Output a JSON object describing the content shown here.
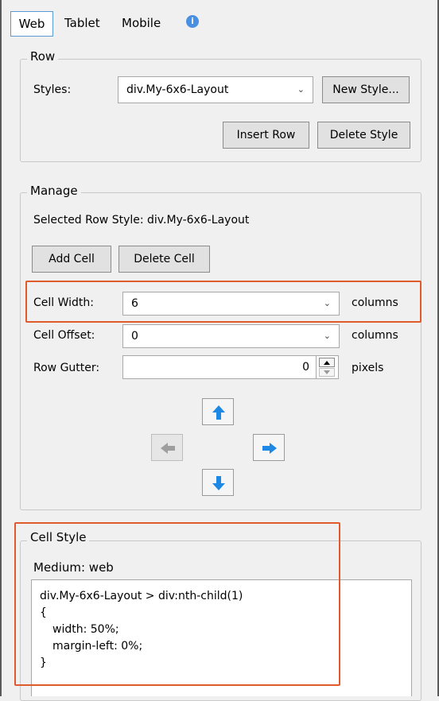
{
  "tabs": [
    "Web",
    "Tablet",
    "Mobile"
  ],
  "info_icon": "info-icon",
  "row": {
    "title": "Row",
    "styles_label": "Styles:",
    "styles_value": "div.My-6x6-Layout",
    "new_style": "New Style...",
    "insert_row": "Insert Row",
    "delete_style": "Delete Style"
  },
  "manage": {
    "title": "Manage",
    "selected_row_style": "Selected Row Style: div.My-6x6-Layout",
    "add_cell": "Add Cell",
    "delete_cell": "Delete Cell",
    "cell_width_label": "Cell Width:",
    "cell_width_value": "6",
    "cell_width_unit": "columns",
    "cell_offset_label": "Cell Offset:",
    "cell_offset_value": "0",
    "cell_offset_unit": "columns",
    "row_gutter_label": "Row Gutter:",
    "row_gutter_value": "0",
    "row_gutter_unit": "pixels"
  },
  "cell_style": {
    "title": "Cell Style",
    "medium": "Medium: web",
    "code": {
      "line1": "div.My-6x6-Layout > div:nth-child(1)",
      "line2": "{",
      "line3": "width: 50%;",
      "line4": "margin-left: 0%;",
      "line5": "}"
    }
  },
  "colors": {
    "highlight": "#e05a2b",
    "arrow": "#1e88e5",
    "arrow_disabled": "#9e9e9e"
  }
}
